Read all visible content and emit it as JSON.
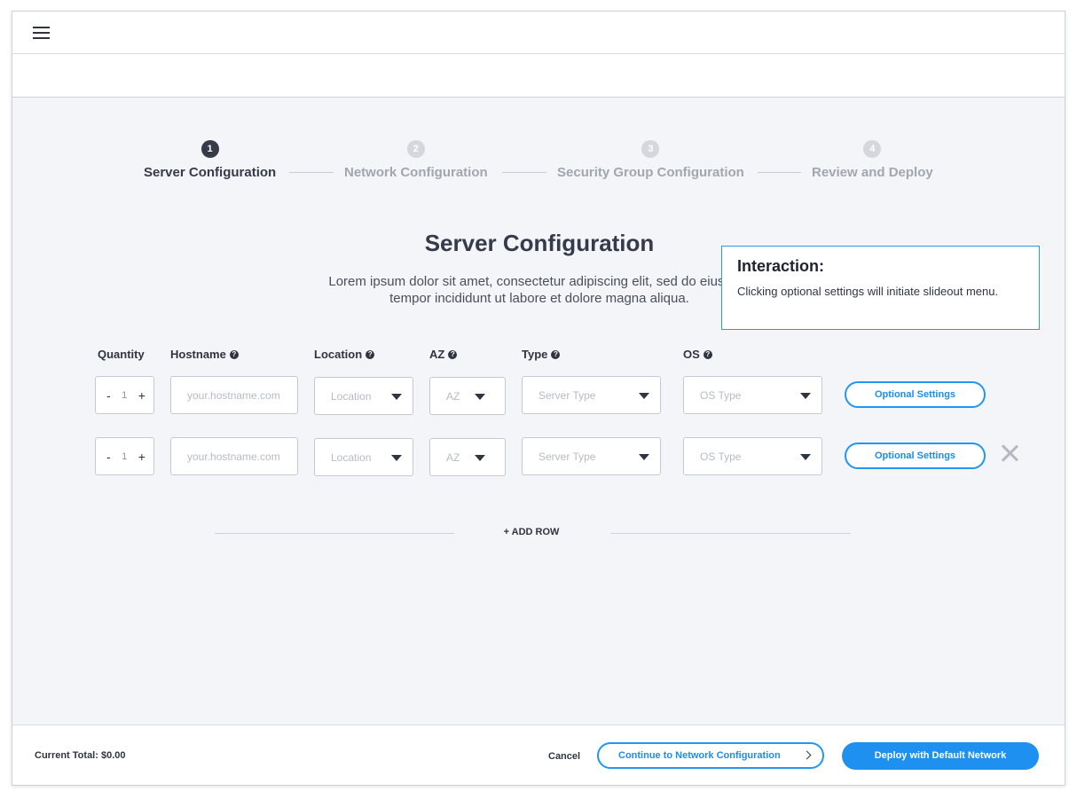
{
  "stepper": [
    {
      "num": "1",
      "label": "Server Configuration",
      "active": true
    },
    {
      "num": "2",
      "label": "Network Configuration",
      "active": false
    },
    {
      "num": "3",
      "label": "Security Group Configuration",
      "active": false
    },
    {
      "num": "4",
      "label": "Review and Deploy",
      "active": false
    }
  ],
  "page": {
    "title": "Server Configuration",
    "description": "Lorem ipsum dolor sit amet, consectetur adipiscing elit, sed do eiusmod tempor incididunt ut labore et dolore magna aliqua."
  },
  "tooltip": {
    "title": "Interaction:",
    "body": "Clicking optional settings will initiate slideout menu."
  },
  "columns": {
    "quantity": "Quantity",
    "hostname": "Hostname",
    "location": "Location",
    "az": "AZ",
    "type": "Type",
    "os": "OS"
  },
  "rows": [
    {
      "qty_minus": "-",
      "qty_value": "1",
      "qty_plus": "+",
      "hostname_placeholder": "your.hostname.com",
      "location": "Location",
      "az": "AZ",
      "type": "Server Type",
      "os": "OS Type",
      "optional_label": "Optional Settings"
    },
    {
      "qty_minus": "-",
      "qty_value": "1",
      "qty_plus": "+",
      "hostname_placeholder": "your.hostname.com",
      "location": "Location",
      "az": "AZ",
      "type": "Server Type",
      "os": "OS Type",
      "optional_label": "Optional Settings"
    }
  ],
  "add_row_label": "+ ADD ROW",
  "footer": {
    "total": "Current Total: $0.00",
    "cancel": "Cancel",
    "continue": "Continue to Network Configuration",
    "deploy": "Deploy with Default Network"
  },
  "colors": {
    "accent": "#1e90f0",
    "text_dark": "#363b4a",
    "text_inactive": "#a2a6ae",
    "background": "#f4f5f8"
  }
}
